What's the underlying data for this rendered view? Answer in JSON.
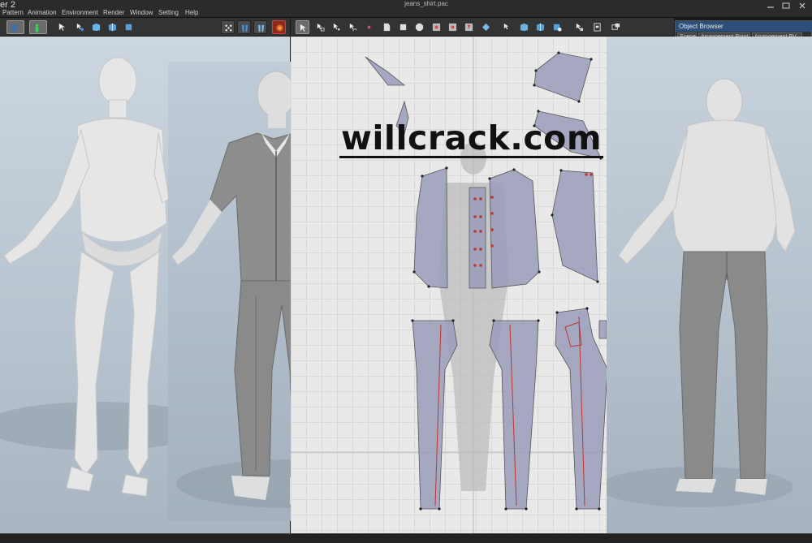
{
  "app": {
    "title_fragment": "er 2",
    "window_title": "jeans_shirt.pac"
  },
  "menu": {
    "items": [
      "Pattern",
      "Animation",
      "Environment",
      "Render",
      "Window",
      "Setting",
      "Help"
    ]
  },
  "object_browser": {
    "title": "Object Browser",
    "tabs": [
      "Scene",
      "Arrangement Point",
      "Arrangement PV"
    ]
  },
  "watermark": {
    "text": "willcrack.com"
  },
  "colors": {
    "menubar": "#2b2b2b",
    "toolbar": "#333333",
    "viewport_bg": "#b9c6d2",
    "pattern_bg": "#e9e9e9",
    "pattern_fill": "#9a9bb8",
    "seam_line": "#c0352e",
    "object_browser_header": "#2c4e78"
  },
  "toolbar_left": {
    "icons": [
      "shirt-icon",
      "avatar-icon",
      "select-icon",
      "move-vertex-icon",
      "fold-icon",
      "fold-icon",
      "arrange-icon",
      "avatar-front-icon",
      "avatar-back-icon",
      "simulation-icon"
    ]
  },
  "toolbar_right": {
    "icons": [
      "select-icon",
      "transform-icon",
      "edit-point-icon",
      "edit-curve-icon",
      "add-point-icon",
      "polygon-icon",
      "rectangle-icon",
      "circle-icon",
      "internal-rect-icon",
      "internal-circle-icon",
      "dart-icon",
      "fold-icon",
      "segment-sewing-icon",
      "free-sewing-icon",
      "check-sewing-icon",
      "pin-icon",
      "texture-icon",
      "view-icon"
    ]
  }
}
